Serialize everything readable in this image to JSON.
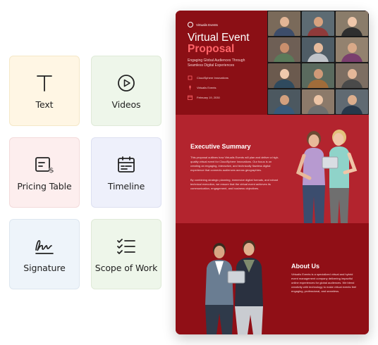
{
  "blocks": [
    {
      "id": "text",
      "label": "Text",
      "icon": "text-icon"
    },
    {
      "id": "videos",
      "label": "Videos",
      "icon": "play-circle-icon"
    },
    {
      "id": "pricing",
      "label": "Pricing Table",
      "icon": "pricing-table-icon"
    },
    {
      "id": "timeline",
      "label": "Timeline",
      "icon": "calendar-icon"
    },
    {
      "id": "signature",
      "label": "Signature",
      "icon": "signature-icon"
    },
    {
      "id": "scope",
      "label": "Scope of Work",
      "icon": "checklist-icon"
    }
  ],
  "proposal": {
    "brand": "Virtualis Events",
    "title_line1": "Virtual Event",
    "title_line2": "Proposal",
    "tagline": "Engaging Global Audiences Through Seamless Digital Experiences",
    "client": "CloudSphere Innovations",
    "company": "Virtualis Events",
    "date": "February 19, 2030",
    "summary_title": "Executive Summary",
    "summary_p1": "This proposal outlines how Virtualis Events will plan and deliver a high-quality virtual event for CloudSphere Innovations. Our focus is on creating an engaging, interactive, and technically flawless digital experience that connects audiences across geographies.",
    "summary_p2": "By combining strategic planning, immersive digital formats, and robust technical execution, we ensure that the virtual event achieves its communication, engagement, and business objectives.",
    "about_title": "About Us",
    "about_p": "Virtualis Events is a specialized virtual and hybrid event management company delivering impactful online experiences for global audiences. We blend creativity with technology to make virtual events feel engaging, professional, and seamless."
  },
  "colors": {
    "cover": "#8b0f15",
    "accent": "#ff6468",
    "summary": "#b3242e",
    "about": "#900f16"
  }
}
